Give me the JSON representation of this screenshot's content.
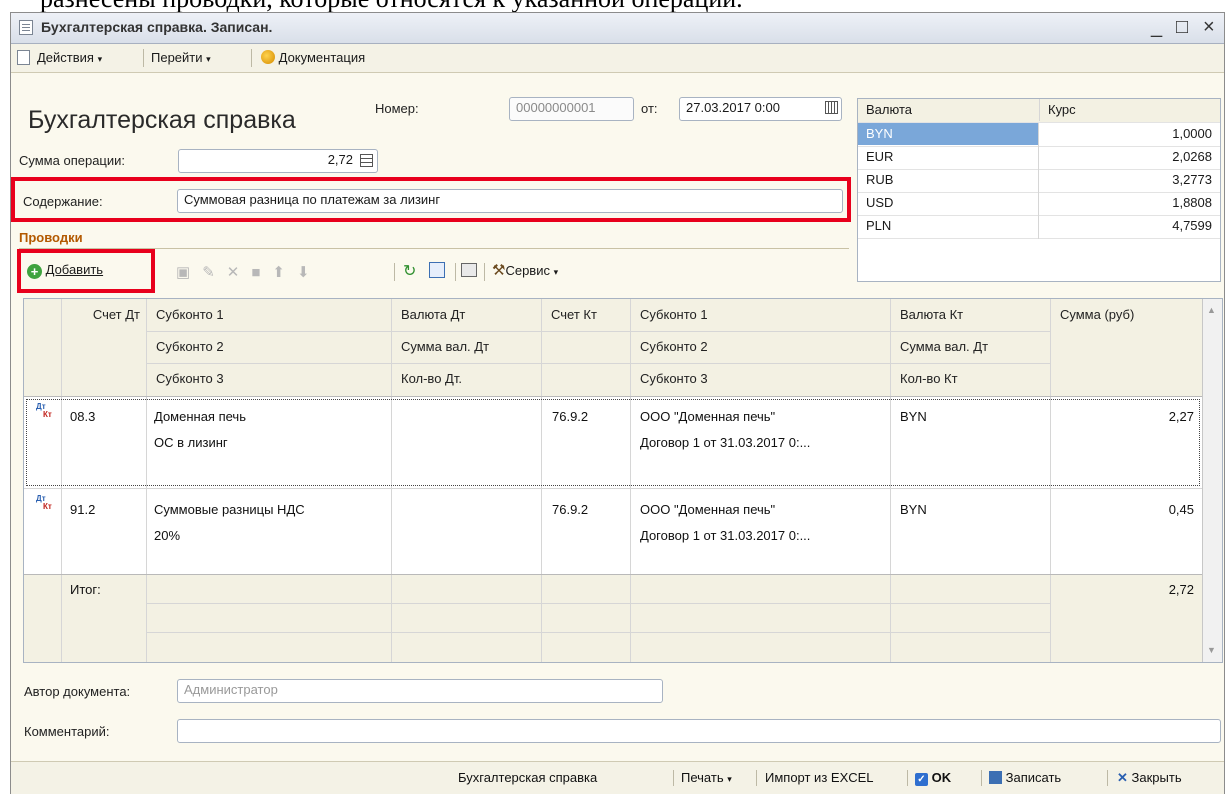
{
  "top_text": "разнесены проводки, которые относятся к указанной операции.",
  "window": {
    "title": "Бухгалтерская справка. Записан.",
    "minimize": "_",
    "maximize": "□",
    "close": "×"
  },
  "toolbar": {
    "actions": "Действия",
    "goto": "Перейти",
    "documentation": "Документация"
  },
  "header": {
    "title": "Бухгалтерская справка",
    "number_label": "Номер:",
    "number_value": "00000000001",
    "date_label": "от:",
    "date_value": "27.03.2017  0:00",
    "amount_label": "Сумма операции:",
    "amount_value": "2,72",
    "content_label": "Содержание:",
    "content_value": "Суммовая разница по платежам за лизинг"
  },
  "currencies": {
    "headers": [
      "Валюта",
      "Курс"
    ],
    "rows": [
      {
        "code": "BYN",
        "rate": "1,0000"
      },
      {
        "code": "EUR",
        "rate": "2,0268"
      },
      {
        "code": "RUB",
        "rate": "3,2773"
      },
      {
        "code": "USD",
        "rate": "1,8808"
      },
      {
        "code": "PLN",
        "rate": "4,7599"
      }
    ]
  },
  "postings": {
    "section_label": "Проводки",
    "add_button": "Добавить",
    "service_button": "Сервис",
    "columns": {
      "debit_account": "Счет Дт",
      "sub1": "Субконто 1",
      "sub2": "Субконто 2",
      "sub3": "Субконто 3",
      "cur_dt": "Валюта Дт",
      "sum_cur_dt": "Сумма вал. Дт",
      "qty_dt": "Кол-во Дт.",
      "credit_account": "Счет Кт",
      "ksub1": "Субконто 1",
      "ksub2": "Субконто 2",
      "ksub3": "Субконто 3",
      "cur_kt": "Валюта Кт",
      "sum_cur_kt": "Сумма вал. Дт",
      "qty_kt": "Кол-во Кт",
      "sum_rub": "Сумма (руб)"
    },
    "rows": [
      {
        "dt": "08.3",
        "dt_sub1": "Доменная печь",
        "dt_sub2": "ОС в лизинг",
        "kt": "76.9.2",
        "kt_sub1": "ООО \"Доменная печь\"",
        "kt_sub2": "Договор  1 от 31.03.2017 0:...",
        "cur_kt": "BYN",
        "sum": "2,27"
      },
      {
        "dt": "91.2",
        "dt_sub1": "Суммовые разницы НДС",
        "dt_sub2": "20%",
        "kt": "76.9.2",
        "kt_sub1": "ООО \"Доменная печь\"",
        "kt_sub2": "Договор  1 от 31.03.2017 0:...",
        "cur_kt": "BYN",
        "sum": "0,45"
      }
    ],
    "total_label": "Итог:",
    "total_value": "2,72"
  },
  "footer": {
    "author_label": "Автор документа:",
    "author_value": "Администратор",
    "comment_label": "Комментарий:",
    "comment_value": ""
  },
  "bottom_bar": {
    "doc": "Бухгалтерская справка",
    "print": "Печать",
    "import": "Импорт из EXCEL",
    "ok": "OK",
    "save": "Записать",
    "close": "Закрыть"
  }
}
